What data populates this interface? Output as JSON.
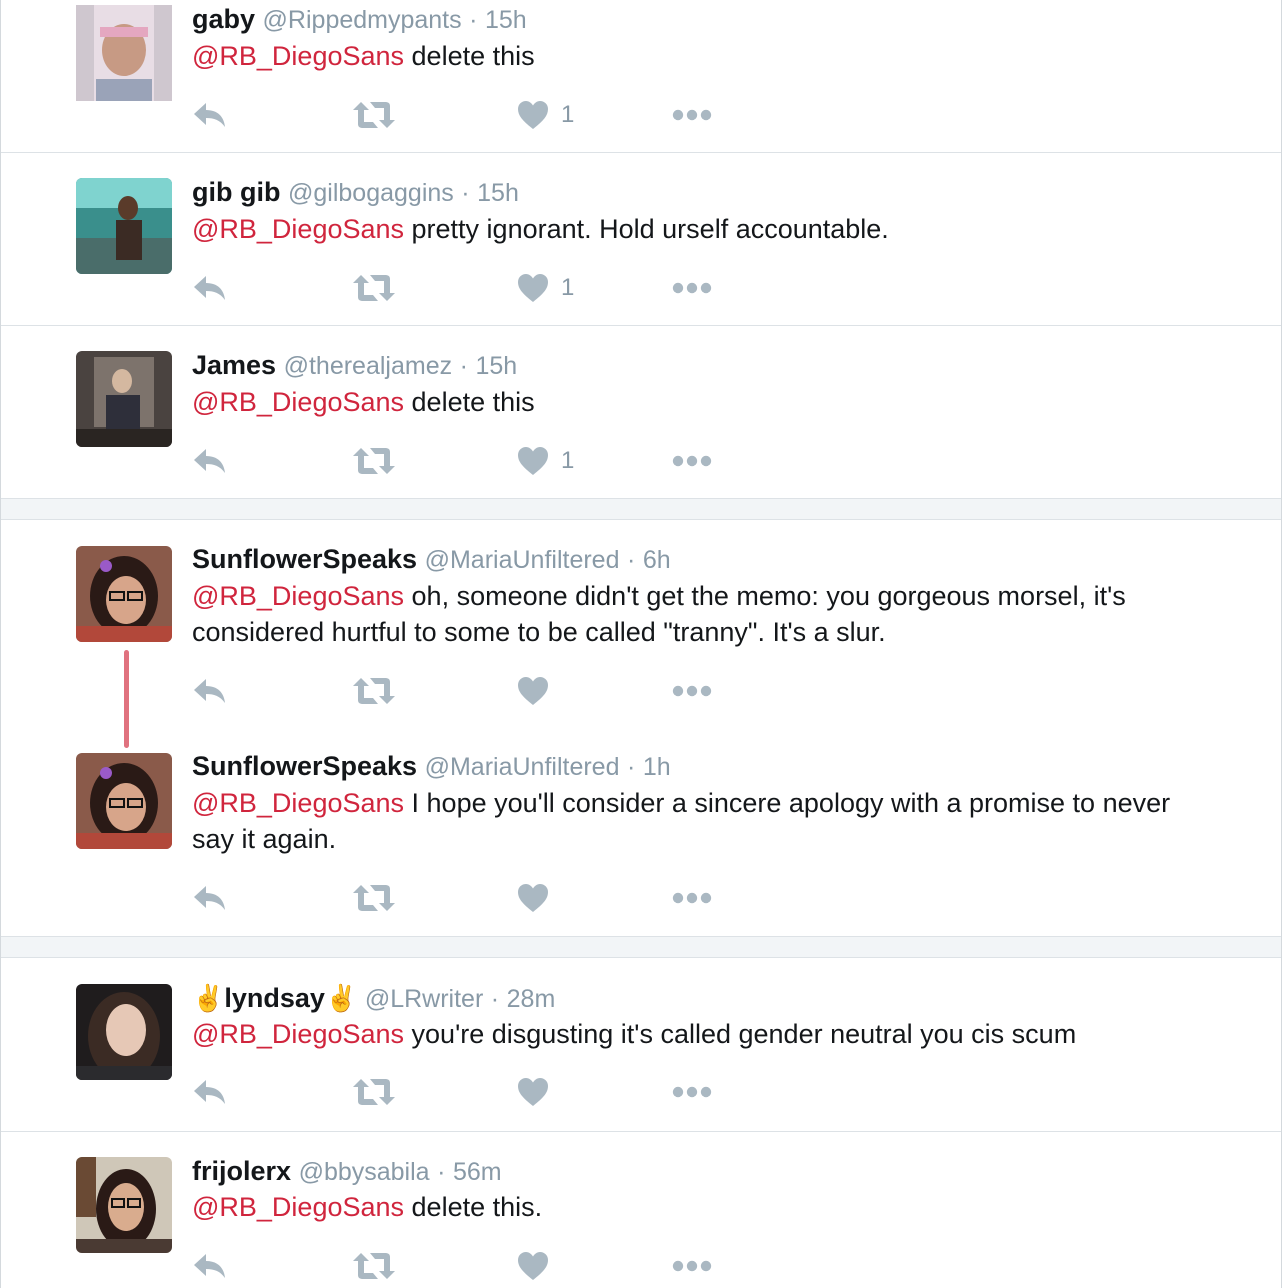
{
  "tweets": [
    {
      "name": "gaby",
      "handle": "@Rippedmypants",
      "dot": "·",
      "time": "15h",
      "mention": "@RB_DiegoSans",
      "text": " delete this",
      "likes": "1"
    },
    {
      "name": "gib gib",
      "handle": "@gilbogaggins",
      "dot": "·",
      "time": "15h",
      "mention": "@RB_DiegoSans",
      "text": " pretty ignorant. Hold urself accountable.",
      "likes": "1"
    },
    {
      "name": "James",
      "handle": "@therealjamez",
      "dot": "·",
      "time": "15h",
      "mention": "@RB_DiegoSans",
      "text": " delete this",
      "likes": "1"
    },
    {
      "name": "SunflowerSpeaks",
      "handle": "@MariaUnfiltered",
      "dot": "·",
      "time": "6h",
      "mention": "@RB_DiegoSans",
      "text": " oh, someone didn't get the memo: you gorgeous morsel, it's considered hurtful to some to be called \"tranny\". It's a slur.",
      "likes": ""
    },
    {
      "name": "SunflowerSpeaks",
      "handle": "@MariaUnfiltered",
      "dot": "·",
      "time": "1h",
      "mention": "@RB_DiegoSans",
      "text": " I hope you'll consider a sincere apology with a promise to never say it again.",
      "likes": ""
    },
    {
      "name_prefix": "✌",
      "name": "lyndsay",
      "name_suffix": "✌",
      "handle": "@LRwriter",
      "dot": "·",
      "time": "28m",
      "mention": "@RB_DiegoSans",
      "text": " you're disgusting it's called gender neutral you cis scum",
      "likes": ""
    },
    {
      "name": "frijolerx",
      "handle": "@bbysabila",
      "dot": "·",
      "time": "56m",
      "mention": "@RB_DiegoSans",
      "text": " delete this.",
      "likes": ""
    }
  ],
  "icons": {
    "reply": "reply-icon",
    "retweet": "retweet-icon",
    "like": "heart-icon",
    "more": "more-icon"
  },
  "colors": {
    "mention": "#d0253d",
    "muted": "#8899a6",
    "icon": "#aab8c2",
    "thread": "#e0727f"
  }
}
